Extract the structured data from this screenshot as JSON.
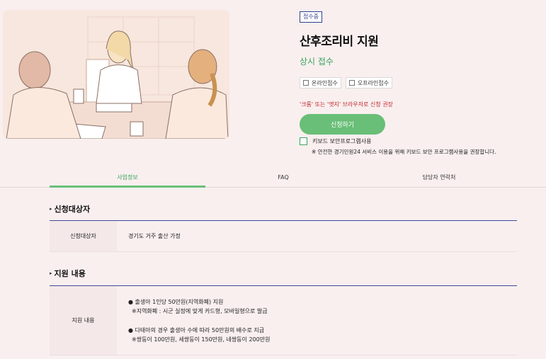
{
  "info": {
    "status_badge": "접수중",
    "title": "산후조리비 지원",
    "subtitle": "상시 접수",
    "methods": [
      "온라인접수",
      "오프라인접수"
    ],
    "notice": "'크롬' 또는 '엣지' 브라우저로 신청 권장",
    "apply_label": "신청하기",
    "keyboard_label": "키보드 보안프로그램사용",
    "keyboard_note": "※ 안전한 경기민원24 서비스 이용을 위해 키보드 보안 프로그램사용을 권장합니다."
  },
  "tabs": [
    "사업정보",
    "FAQ",
    "담당자 연락처"
  ],
  "sections": {
    "target": {
      "title": "신청대상자",
      "label": "신청대상자",
      "value": "경기도 거주 출산 가정"
    },
    "support": {
      "title": "지원 내용",
      "label": "지원 내용",
      "lines": [
        "● 출생아 1인당 50만원(지역화폐) 지원",
        "※지역화폐 : 시군 실정에 맞게 카드형, 모바일형으로 발급",
        "● 다태아의 경우 출생아 수에 따라 50만원의 배수로 지급",
        "※쌍둥이 100만원, 세쌍둥이 150만원, 네쌍둥이 200만원"
      ]
    }
  },
  "colors": {
    "accent_green": "#69bf77",
    "notice_red": "#c0272d",
    "section_line_blue": "#3d4b9c",
    "background": "#f9efef"
  }
}
